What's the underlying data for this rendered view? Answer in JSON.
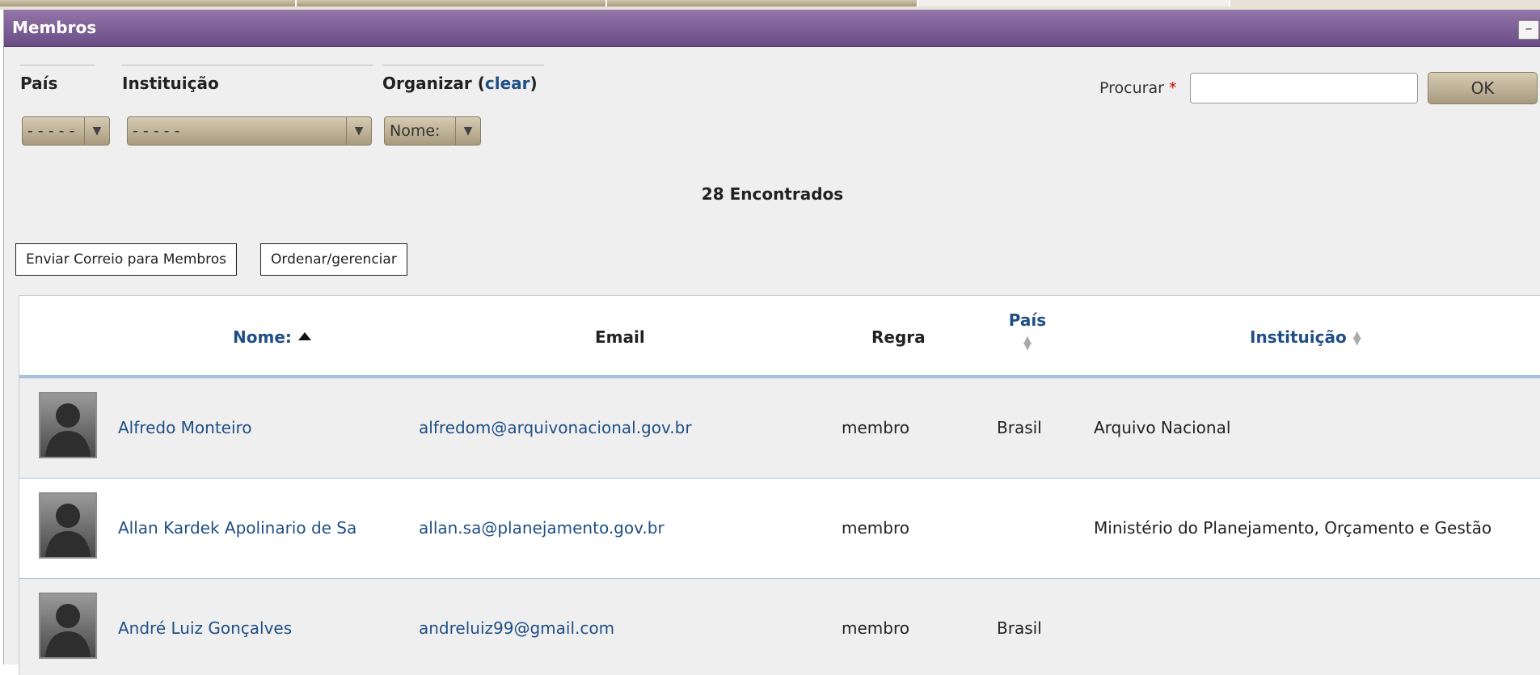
{
  "panel": {
    "title": "Membros",
    "minimize_glyph": "–"
  },
  "filters": {
    "pais": {
      "label": "País",
      "value": "- - - - -"
    },
    "instituicao": {
      "label": "Instituição",
      "value": "- - - - -"
    },
    "organizar": {
      "label": "Organizar",
      "clear_label": "clear",
      "value": "Nome:"
    }
  },
  "search": {
    "label": "Procurar",
    "required_mark": "*",
    "value": "",
    "placeholder": "",
    "submit_label": "OK"
  },
  "results_count": "28 Encontrados",
  "actions": {
    "email_members": "Enviar Correio para Membros",
    "sort_manage": "Ordenar/gerenciar"
  },
  "table": {
    "columns": {
      "nome": "Nome:",
      "email": "Email",
      "regra": "Regra",
      "pais": "País",
      "instituicao": "Instituição"
    },
    "rows": [
      {
        "nome": "Alfredo Monteiro",
        "email": "alfredom@arquivonacional.gov.br",
        "regra": "membro",
        "pais": "Brasil",
        "instituicao": "Arquivo Nacional"
      },
      {
        "nome": "Allan Kardek Apolinario de Sa",
        "email": "allan.sa@planejamento.gov.br",
        "regra": "membro",
        "pais": "",
        "instituicao": "Ministério do Planejamento, Orçamento e Gestão"
      },
      {
        "nome": "André Luiz Gonçalves",
        "email": "andreluiz99@gmail.com",
        "regra": "membro",
        "pais": "Brasil",
        "instituicao": ""
      }
    ]
  },
  "colors": {
    "titlebar": "#7a5c94",
    "link": "#1f4f85",
    "button_tan": "#c2b699",
    "row_divider": "#a7c0e0"
  },
  "icons": {
    "avatar": "default-avatar-silhouette",
    "sort_asc": "sort-ascending-icon",
    "sort_both": "sortable-icon"
  }
}
